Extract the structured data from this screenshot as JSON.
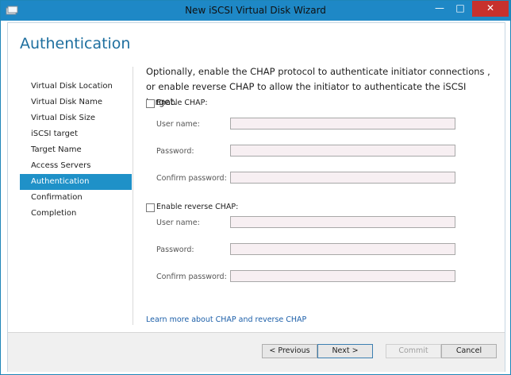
{
  "window": {
    "title": "New iSCSI Virtual Disk Wizard",
    "minimize": "—",
    "maximize": "□",
    "close": "✕",
    "app_icon": "wizard-app-icon"
  },
  "page": {
    "title": "Authentication",
    "description": "Optionally, enable the CHAP protocol to authenticate initiator connections , or enable reverse CHAP to allow the initiator to authenticate the iSCSI target."
  },
  "nav": {
    "items": [
      {
        "label": "Virtual Disk Location"
      },
      {
        "label": "Virtual Disk Name"
      },
      {
        "label": "Virtual Disk Size"
      },
      {
        "label": "iSCSI target"
      },
      {
        "label": "Target Name"
      },
      {
        "label": "Access Servers"
      },
      {
        "label": "Authentication",
        "active": true
      },
      {
        "label": "Confirmation"
      },
      {
        "label": "Completion"
      }
    ]
  },
  "chap": {
    "label": "Enable CHAP:",
    "checked": false,
    "user_name_label": "User name:",
    "user_name_value": "",
    "password_label": "Password:",
    "password_value": "",
    "confirm_label": "Confirm password:",
    "confirm_value": ""
  },
  "reverse_chap": {
    "label": "Enable reverse CHAP:",
    "checked": false,
    "user_name_label": "User name:",
    "user_name_value": "",
    "password_label": "Password:",
    "password_value": "",
    "confirm_label": "Confirm password:",
    "confirm_value": ""
  },
  "link": {
    "text": "Learn more about CHAP and reverse CHAP"
  },
  "buttons": {
    "previous": "< Previous",
    "next": "Next >",
    "commit": "Commit",
    "cancel": "Cancel"
  },
  "colors": {
    "titlebar": "#1e88c6",
    "accent": "#1f91c8",
    "close": "#c7312d",
    "heading": "#1e6f9f"
  }
}
